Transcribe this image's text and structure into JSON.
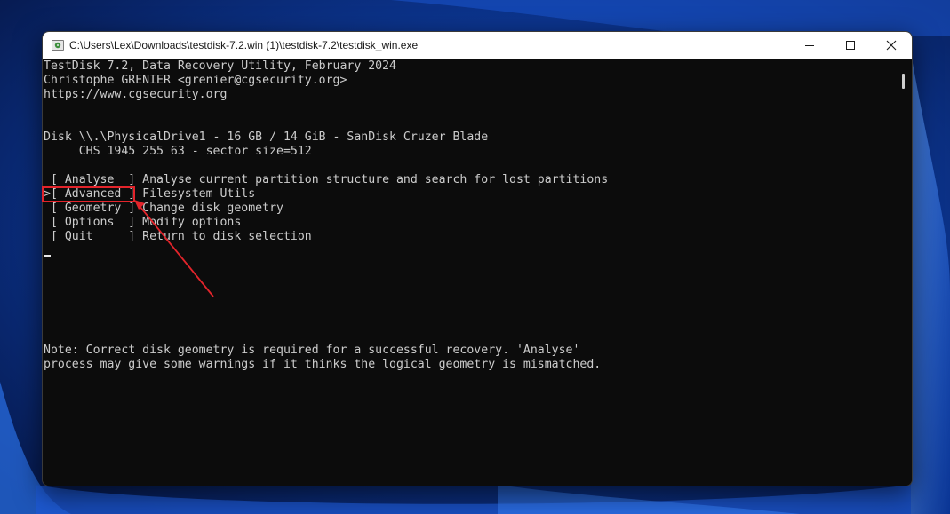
{
  "window": {
    "title": "C:\\Users\\Lex\\Downloads\\testdisk-7.2.win (1)\\testdisk-7.2\\testdisk_win.exe",
    "icons": {
      "app": "testdisk-app-icon",
      "minimize": "minimize-icon",
      "maximize": "maximize-icon",
      "close": "close-icon"
    }
  },
  "console": {
    "header": [
      "TestDisk 7.2, Data Recovery Utility, February 2024",
      "Christophe GRENIER <grenier@cgsecurity.org>",
      "https://www.cgsecurity.org"
    ],
    "disk": {
      "line": "Disk \\\\.\\PhysicalDrive1 - 16 GB / 14 GiB - SanDisk Cruzer Blade",
      "chs": "     CHS 1945 255 63 - sector size=512"
    },
    "menu": [
      {
        "label": " [ Analyse  ] Analyse current partition structure and search for lost partitions"
      },
      {
        "label": ">[ Advanced ] Filesystem Utils"
      },
      {
        "label": " [ Geometry ] Change disk geometry"
      },
      {
        "label": " [ Options  ] Modify options"
      },
      {
        "label": " [ Quit     ] Return to disk selection"
      }
    ],
    "selected_index": 1,
    "note": [
      "Note: Correct disk geometry is required for a successful recovery. 'Analyse'",
      "process may give some warnings if it thinks the logical geometry is mismatched."
    ]
  },
  "colors": {
    "console_bg": "#0c0c0c",
    "console_text": "#cccccc",
    "annotation": "#e3242b",
    "wallpaper": "#0a2a6e"
  }
}
